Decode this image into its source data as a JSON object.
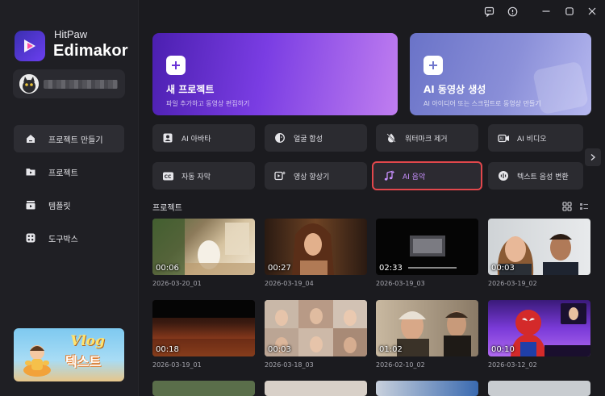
{
  "app": {
    "brand_line1": "HitPaw",
    "brand_line2": "Edimakor"
  },
  "sidebar": {
    "items": [
      {
        "label": "프로젝트 만들기",
        "icon": "home-icon",
        "active": true
      },
      {
        "label": "프로젝트",
        "icon": "folder-icon",
        "active": false
      },
      {
        "label": "템플릿",
        "icon": "template-icon",
        "active": false
      },
      {
        "label": "도구박스",
        "icon": "toolbox-icon",
        "active": false
      }
    ],
    "promo": {
      "title": "Vlog",
      "text": "텍스트"
    }
  },
  "hero": [
    {
      "title": "새 프로젝트",
      "subtitle": "파일 추가하고 동영상 편집하기",
      "color": "#7a3de3"
    },
    {
      "title": "AI 동영상 생성",
      "subtitle": "AI 아이디어 또는 스크립트로 동영상 만들기",
      "color": "#8a8fd8"
    }
  ],
  "tools": [
    {
      "label": "AI 아바타",
      "icon": "avatar-icon"
    },
    {
      "label": "얼굴 합성",
      "icon": "face-swap-icon"
    },
    {
      "label": "워터마크 제거",
      "icon": "watermark-remove-icon"
    },
    {
      "label": "AI 비디오",
      "icon": "ai-video-icon"
    },
    {
      "label": "자동 자막",
      "icon": "subtitle-icon"
    },
    {
      "label": "영상 향상기",
      "icon": "video-enhance-icon"
    },
    {
      "label": "AI 음악",
      "icon": "music-icon",
      "selected": true
    },
    {
      "label": "텍스트 음성 변환",
      "icon": "tts-icon"
    }
  ],
  "projects": {
    "title": "프로젝트",
    "items": [
      {
        "name": "2026-03-20_01",
        "duration": "00:06"
      },
      {
        "name": "2026-03-19_04",
        "duration": "00:27"
      },
      {
        "name": "2026-03-19_03",
        "duration": "02:33"
      },
      {
        "name": "2026-03-19_02",
        "duration": "00:03"
      },
      {
        "name": "2026-03-19_01",
        "duration": "00:18"
      },
      {
        "name": "2026-03-18_03",
        "duration": "00:03"
      },
      {
        "name": "2026-02-10_02",
        "duration": "01:02"
      },
      {
        "name": "2026-03-12_02",
        "duration": "00:10"
      }
    ]
  },
  "colors": {
    "accent": "#c890ff",
    "selection_border": "#e2474c",
    "background": "#1b1b1f"
  }
}
